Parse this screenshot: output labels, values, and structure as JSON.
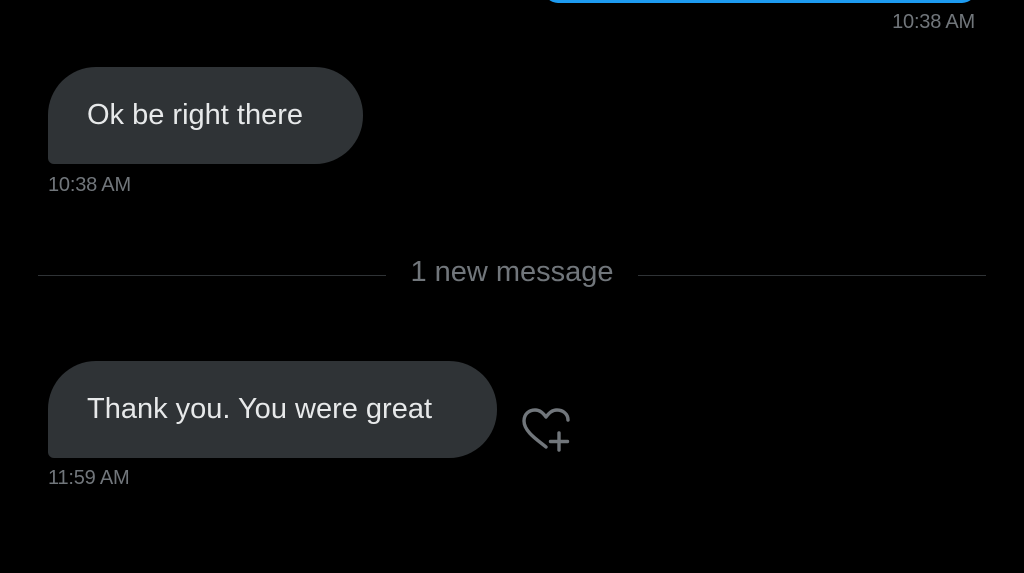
{
  "thread": {
    "sent_timestamp": "10:38 AM",
    "messages": [
      {
        "text": "Ok be right there",
        "timestamp": "10:38 AM"
      },
      {
        "text": "Thank you. You were great",
        "timestamp": "11:59 AM"
      }
    ],
    "divider_label": "1 new message",
    "react_icon": "heart-plus-icon"
  },
  "colors": {
    "background": "#000000",
    "sent_bubble": "#1d9bf0",
    "received_bubble": "#2f3336",
    "text": "#e7e9ea",
    "muted": "#71767b"
  }
}
